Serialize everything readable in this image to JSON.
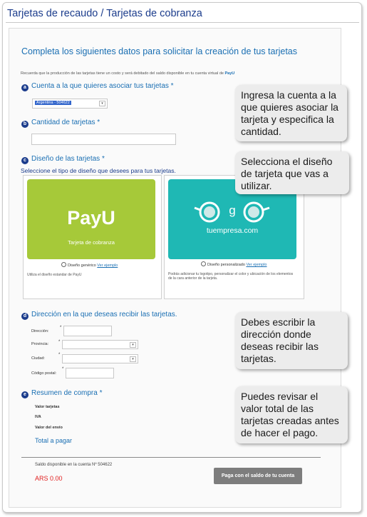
{
  "header": {
    "title": "Tarjetas de recaudo / Tarjetas de cobranza"
  },
  "form": {
    "intro": "Completa los siguientes datos para solicitar la creación de tus tarjetas",
    "note": "Recuerda que la producción de las tarjetas tiene un costo y será debitado del saldo disponible en tu cuenta virtual de",
    "note_brand": "PayU",
    "sections": {
      "a": {
        "letter": "a",
        "title": "Cuenta a la que quieres asociar tus tarjetas *",
        "selected": "Argentina - 504622"
      },
      "b": {
        "letter": "b",
        "title": "Cantidad de tarjetas *",
        "value": ""
      },
      "c": {
        "letter": "c",
        "title": "Diseño de las tarjetas *",
        "subtitle": "Seleccione el tipo de diseño que desees para tus tarjetas."
      },
      "d": {
        "letter": "d",
        "title": "Dirección en la que deseas recibir las tarjetas."
      },
      "e": {
        "letter": "e",
        "title": "Resumen de compra *"
      }
    },
    "designs": [
      {
        "brand": "PayU",
        "card_text": "Tarjeta de cobranza",
        "option": "Diseño genérico",
        "example_link": "Ver ejemplo",
        "description": "Utiliza el diseño estandar de PayU",
        "color": "#a6c939"
      },
      {
        "card_text": "tuempresa.com",
        "logo_letter": "g",
        "option": "Diseño personalizado",
        "example_link": "Ver ejemplo",
        "description": "Podrás adicionar tu logotipo, personalizar el color y ubicación de los elementos de la cara anterior de la tarjeta.",
        "color": "#1fb8b4"
      }
    ],
    "address": {
      "direccion_label": "Dirección:",
      "provincia_label": "Provincia:",
      "ciudad_label": "Ciudad:",
      "codigo_label": "Código postal:",
      "required_mark": "*"
    },
    "summary": {
      "valor_tarjetas": "Valor tarjetas",
      "iva": "IVA",
      "valor_envio": "Valor del envío",
      "total": "Total a pagar"
    },
    "footer": {
      "saldo_label": "Saldo disponible en la cuenta Nº 504622",
      "amount": "ARS 0.00",
      "pay_button": "Paga con el saldo de tu cuenta"
    }
  },
  "tips": [
    "Ingresa la cuenta a la que quieres asociar la tarjeta y especifica la cantidad.",
    "Selecciona el diseño de tarjeta que vas a utilizar.",
    "Debes escribir la dirección donde deseas recibir las tarjetas.",
    "Puedes revisar el valor total de las tarjetas creadas antes de hacer el pago."
  ],
  "colors": {
    "accent": "#1a6fb3",
    "header": "#1b3c8c",
    "amount": "#e02020",
    "button": "#7d7d7d"
  }
}
